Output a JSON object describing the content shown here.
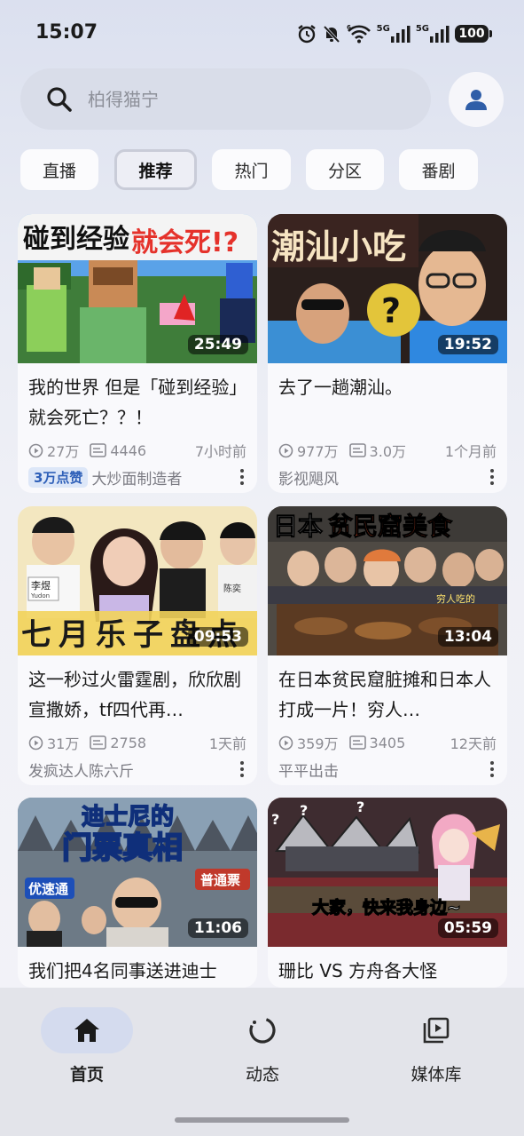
{
  "status_bar": {
    "time": "15:07",
    "signal_1": "5G",
    "signal_2": "5G",
    "battery": "100"
  },
  "search": {
    "placeholder": "柏得猫宁"
  },
  "tabs": [
    {
      "label": "直播"
    },
    {
      "label": "推荐"
    },
    {
      "label": "热门"
    },
    {
      "label": "分区"
    },
    {
      "label": "番剧"
    }
  ],
  "active_tab": "推荐",
  "videos": [
    {
      "title": "我的世界 但是「碰到经验」就会死亡？？！",
      "duration": "25:49",
      "views": "27万",
      "danmaku": "4446",
      "time": "7小时前",
      "badge": "3万点赞",
      "author": "大炒面制造者",
      "thumb_text": [
        "碰到经验",
        "就会死!?"
      ]
    },
    {
      "title": "去了一趟潮汕。",
      "duration": "19:52",
      "views": "977万",
      "danmaku": "3.0万",
      "time": "1个月前",
      "author": "影视飓风",
      "thumb_text": [
        "潮汕小吃"
      ]
    },
    {
      "title": "这一秒过火雷霆剧，欣欣剧宣撒娇，tf四代再…",
      "duration": "09:53",
      "views": "31万",
      "danmaku": "2758",
      "time": "1天前",
      "author": "发疯达人陈六斤",
      "thumb_text": [
        "七月乐子盘点",
        "李煜",
        "Yudon",
        "陈奕"
      ]
    },
    {
      "title": "在日本贫民窟脏摊和日本人打成一片！穷人…",
      "duration": "13:04",
      "views": "359万",
      "danmaku": "3405",
      "time": "12天前",
      "author": "平平出击",
      "thumb_text": [
        "日本",
        "贫民窟美食",
        "穷人吃的"
      ]
    },
    {
      "title": "我们把4名同事送进迪士",
      "duration": "11:06",
      "thumb_text": [
        "迪士尼的",
        "门票真相",
        "优速通",
        "普通票"
      ]
    },
    {
      "title": "珊比 VS 方舟各大怪",
      "duration": "05:59",
      "thumb_text": [
        "大家，快来我身边~"
      ]
    }
  ],
  "bottom_nav": [
    {
      "label": "首页",
      "icon": "home-icon"
    },
    {
      "label": "动态",
      "icon": "activity-ring-icon"
    },
    {
      "label": "媒体库",
      "icon": "media-library-icon"
    }
  ],
  "colors": {
    "accent_blue": "#2e5fb8",
    "nav_active_bg": "#d4dbee"
  }
}
